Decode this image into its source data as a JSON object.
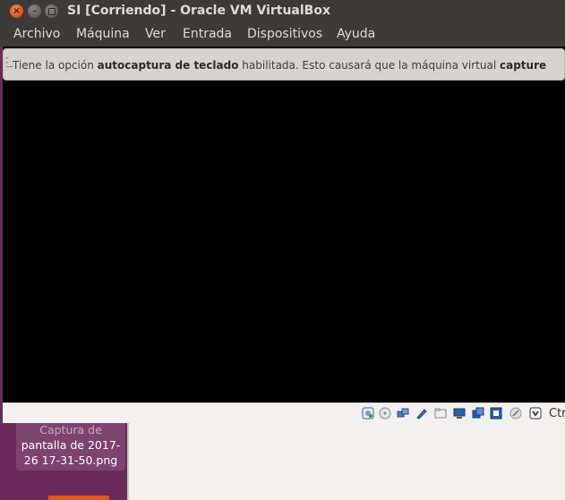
{
  "window": {
    "title": "SI [Corriendo] - Oracle VM VirtualBox"
  },
  "menubar": {
    "items": [
      "Archivo",
      "Máquina",
      "Ver",
      "Entrada",
      "Dispositivos",
      "Ayuda"
    ]
  },
  "notice": {
    "text_1": "Tiene la opción ",
    "bold_1": "autocaptura de teclado",
    "text_2": " habilitada. Esto causará que la máquina virtual ",
    "bold_2": "capture"
  },
  "statusbar": {
    "host_key_label": "Ctr",
    "icons": [
      "hard-disk-icon",
      "optical-drive-icon",
      "network-icon",
      "usb-icon",
      "shared-folders-icon",
      "display-icon",
      "video-capture-icon",
      "virtualization-icon",
      "mouse-integration-icon",
      "host-key-icon"
    ]
  },
  "desktop": {
    "file_label_line1": "Captura de",
    "file_label_line2": "pantalla de 2017-",
    "file_label_line3": "26 17-31-50.png"
  },
  "colors": {
    "titlebar": "#3c3b37",
    "close_button": "#e2581f",
    "vm_display": "#000000",
    "desktop": "#6b2a5c"
  }
}
